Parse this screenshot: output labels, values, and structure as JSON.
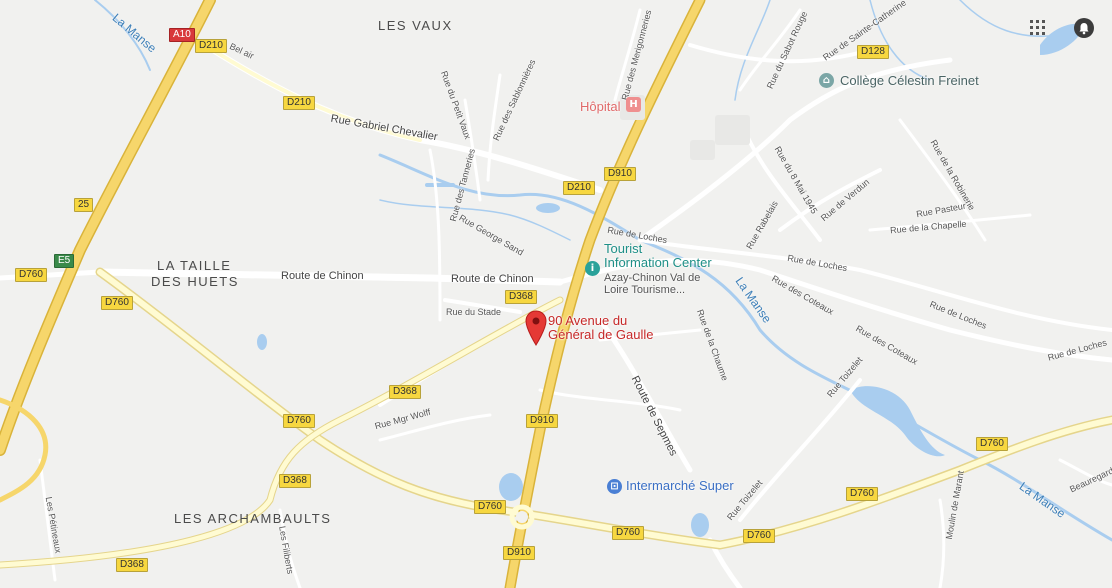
{
  "colors": {
    "land": "#f1f1ef",
    "motorway": "#f6d66b",
    "primary_road": "#fff8c0",
    "road": "#ffffff",
    "water": "#a9cdef",
    "pin": "#d93025"
  },
  "areas": {
    "les_vaux": "LES VAUX",
    "la_taille": "LA TAILLE",
    "des_huets": "DES HUETS",
    "les_archambaults": "LES ARCHAMBAULTS"
  },
  "streets": {
    "bel_air": "Bel air",
    "gabriel_chevalier": "Rue Gabriel Chevalier",
    "petit_vaux": "Rue du Petit Vaux",
    "sablonnieres": "Rue des Sablonnières",
    "tanneries": "Rue des Tanneries",
    "george_sand": "Rue George Sand",
    "route_chinon_left": "Route de Chinon",
    "route_chinon_right": "Route de Chinon",
    "rue_du_stade": "Rue du Stade",
    "mgr_wolff": "Rue Mgr Wolff",
    "petineaux": "Les Pétineaux",
    "filiberts": "Les Filiberts",
    "merigonneries": "Rue des Merigonneries",
    "sabot_rouge": "Rue du Sabot Rouge",
    "sainte_catherine": "Rue de Sainte-Catherine",
    "huit_mai": "Rue du 8 Mai 1945",
    "rabelais": "Rue Rabelais",
    "verdun": "Rue de Verdun",
    "robinerie": "Rue de la Robinerie",
    "pasteur": "Rue Pasteur",
    "la_chapelle": "Rue de la Chapelle",
    "loches_1": "Rue de Loches",
    "loches_2": "Rue de Loches",
    "loches_3": "Rue de Loches",
    "loches_4": "Rue de Loches",
    "coteaux_1": "Rue des Coteaux",
    "coteaux_2": "Rue des Coteaux",
    "chaume": "Rue de la Chaume",
    "route_sepmes": "Route de Sepmes",
    "toizelet_1": "Rue Toizelet",
    "toizelet_2": "Rue Toizelet",
    "moulin_marant": "Moulin de Marant",
    "beauregard": "Beauregard"
  },
  "water_labels": {
    "manse_1": "La Manse",
    "manse_2": "La Manse",
    "manse_3": "La Manse"
  },
  "shields": {
    "a10": "A10",
    "e5": "E5",
    "n25": "25",
    "d210_1": "D210",
    "d210_2": "D210",
    "d210_3": "D210",
    "d910_1": "D910",
    "d910_2": "D910",
    "d910_3": "D910",
    "d760_1": "D760",
    "d760_2": "D760",
    "d760_3": "D760",
    "d760_4": "D760",
    "d760_5": "D760",
    "d760_6": "D760",
    "d760_7": "D760",
    "d760_8": "D760",
    "d368_1": "D368",
    "d368_2": "D368",
    "d368_3": "D368",
    "d368_4": "D368",
    "d128": "D128"
  },
  "pois": {
    "hopital": "Hôpital",
    "college": "Collège Célestin Freinet",
    "tourist_line1": "Tourist",
    "tourist_line2": "Information Center",
    "tourist_sub1": "Azay-Chinon Val de",
    "tourist_sub2": "Loire Tourisme...",
    "intermarche": "Intermarché Super"
  },
  "pin": {
    "line1": "90 Avenue du",
    "line2": "Général de Gaulle"
  },
  "icons": {
    "apps": "apps-grid-icon",
    "notifications": "notification-bell-icon",
    "pin": "location-pin-icon",
    "hospital": "hospital-icon",
    "school": "school-icon",
    "tourist": "tourist-info-icon",
    "shopping": "shopping-cart-icon"
  }
}
